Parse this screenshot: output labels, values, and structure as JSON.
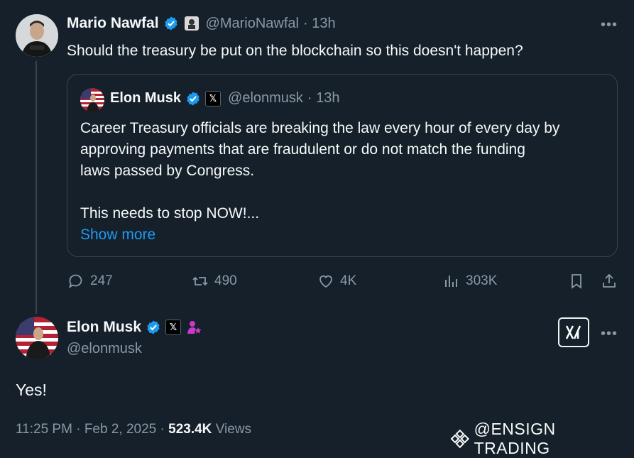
{
  "main_tweet": {
    "author_name": "Mario Nawfal",
    "handle": "@MarioNawfal",
    "time": "· 13h",
    "text": "Should the treasury be put on the blockchain so this doesn't happen?"
  },
  "quoted_tweet": {
    "author_name": "Elon Musk",
    "handle": "@elonmusk",
    "time": "· 13h",
    "text_line1": "Career Treasury officials are breaking the law every hour of every day by",
    "text_line2": "approving payments that are fraudulent or do not match the funding",
    "text_line3": "laws passed by Congress.",
    "text_line4": "This needs to stop NOW!...",
    "show_more": "Show more"
  },
  "actions": {
    "replies": "247",
    "reposts": "490",
    "likes": "4K",
    "views": "303K"
  },
  "reply_tweet": {
    "author_name": "Elon Musk",
    "handle": "@elonmusk",
    "text": "Yes!",
    "time": "11:25 PM",
    "sep1": "·",
    "date": "Feb 2, 2025",
    "sep2": "·",
    "views_count": "523.4K",
    "views_label": "Views"
  },
  "watermark": {
    "text": "@ENSIGN TRADING"
  },
  "icons": [
    "verified-badge-icon",
    "reply-icon",
    "repost-icon",
    "like-icon",
    "views-icon",
    "bookmark-icon",
    "share-icon",
    "more-icon",
    "grok-icon",
    "x-logo-icon",
    "binance-logo-icon"
  ],
  "colors": {
    "background": "#15202b",
    "accent": "#1d9bf0",
    "muted": "#8b98a5",
    "border": "#38444d"
  }
}
